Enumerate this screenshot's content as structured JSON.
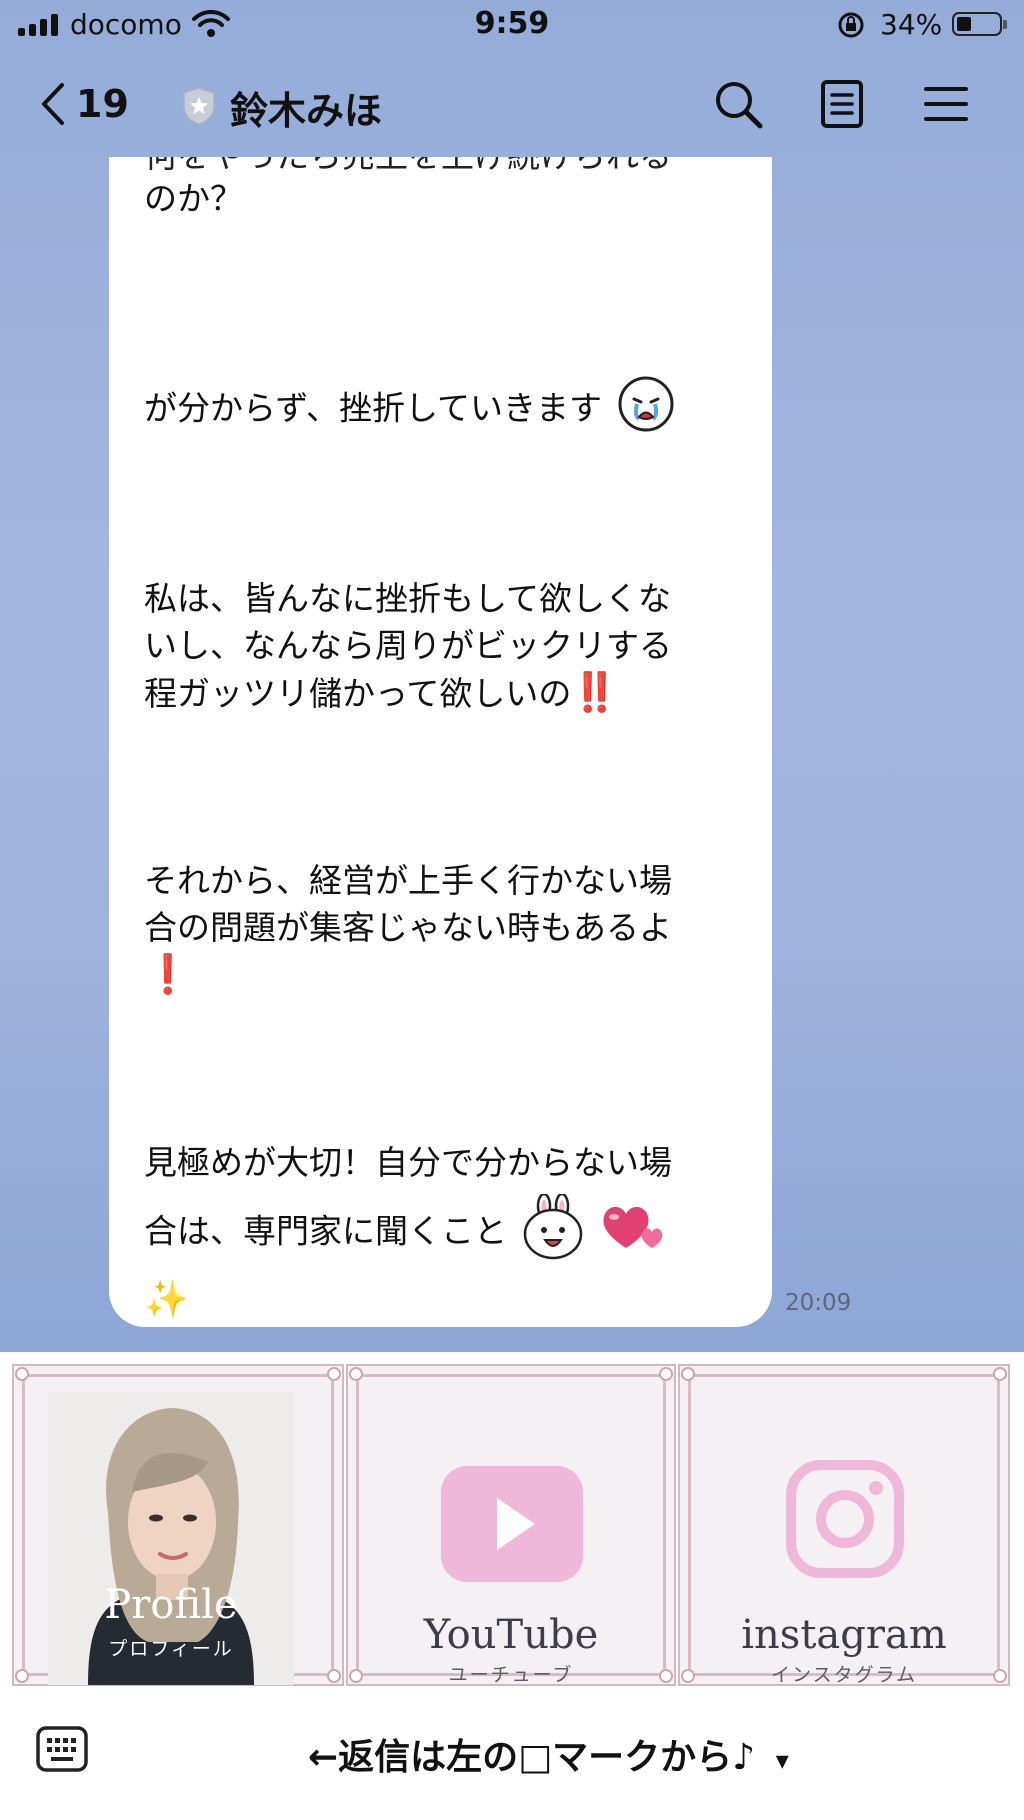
{
  "status_bar": {
    "carrier": "docomo",
    "time": "9:59",
    "battery_pct": "34%",
    "battery_level": 0.34
  },
  "header": {
    "back_count": "19",
    "chat_name": "鈴木みほ",
    "icons": [
      "search-icon",
      "notes-icon",
      "menu-icon"
    ]
  },
  "message": {
    "clipped_line": "何をやったら売上を上げ続けられる",
    "p1_line2": "のか？",
    "p2": "が分からず、挫折していきます",
    "p3_l1": "私は、皆んなに挫折もして欲しくな",
    "p3_l2": "いし、なんなら周りがビックリする",
    "p3_l3": "程ガッツリ儲かって欲しいの",
    "p3_mark": "‼️",
    "p4_l1": "それから、経営が上手く行かない場",
    "p4_l2": "合の問題が集客じゃない時もあるよ",
    "p4_mark": "❗",
    "p5_l1": "見極めが大切！自分で分からない場",
    "p5_l2": "合は、専門家に聞くこと",
    "p5_sparkle": "✨",
    "time": "20:09"
  },
  "rich_menu": {
    "tiles": [
      {
        "main": "Profile",
        "sub": "プロフィール"
      },
      {
        "main": "YouTube",
        "sub": "ユーチューブ"
      },
      {
        "main": "instagram",
        "sub": "インスタグラム"
      }
    ],
    "accent": "#f0b8d8"
  },
  "bottom": {
    "reply_text": "←返信は左の□マークから♪",
    "dropdown": "▾"
  }
}
